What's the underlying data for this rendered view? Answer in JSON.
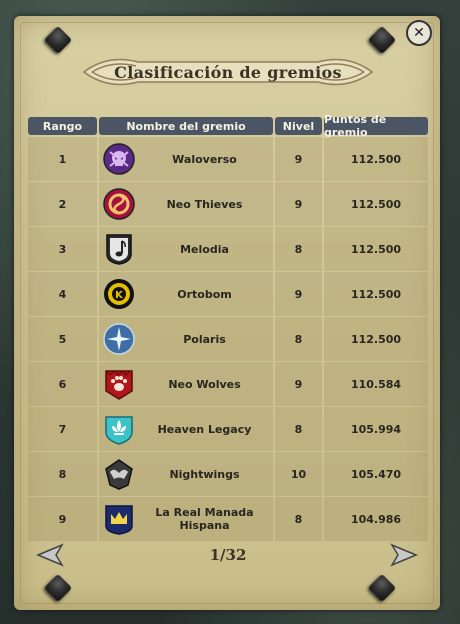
{
  "title": "Clasificación de gremios",
  "close_icon": "close-icon",
  "columns": [
    "Rango",
    "Nombre del gremio",
    "Nivel",
    "Puntos de gremio"
  ],
  "guilds": [
    {
      "rank": "1",
      "name": "Waloverso",
      "level": "9",
      "points": "112.500",
      "emblem": "skull-emblem",
      "emblem_color": "#5b2a86"
    },
    {
      "rank": "2",
      "name": "Neo Thieves",
      "level": "9",
      "points": "112.500",
      "emblem": "swirl-emblem",
      "emblem_color": "#a4123f"
    },
    {
      "rank": "3",
      "name": "Melodia",
      "level": "8",
      "points": "112.500",
      "emblem": "music-note-emblem",
      "emblem_color": "#2c2c2c"
    },
    {
      "rank": "4",
      "name": "Ortobom",
      "level": "9",
      "points": "112.500",
      "emblem": "k-emblem",
      "emblem_color": "#e6c000"
    },
    {
      "rank": "5",
      "name": "Polaris",
      "level": "8",
      "points": "112.500",
      "emblem": "star-compass-emblem",
      "emblem_color": "#3f6ea6"
    },
    {
      "rank": "6",
      "name": "Neo Wolves",
      "level": "9",
      "points": "110.584",
      "emblem": "paw-emblem",
      "emblem_color": "#b0161a"
    },
    {
      "rank": "7",
      "name": "Heaven Legacy",
      "level": "8",
      "points": "105.994",
      "emblem": "fleur-emblem",
      "emblem_color": "#3cc3c9"
    },
    {
      "rank": "8",
      "name": "Nightwings",
      "level": "10",
      "points": "105.470",
      "emblem": "wing-emblem",
      "emblem_color": "#3a3a3a"
    },
    {
      "rank": "9",
      "name": "La Real Manada Hispana",
      "level": "8",
      "points": "104.986",
      "emblem": "crown-emblem",
      "emblem_color": "#1d2a6b"
    }
  ],
  "pagination": {
    "label": "1/32",
    "prev_icon": "arrow-left-icon",
    "next_icon": "arrow-right-icon"
  }
}
